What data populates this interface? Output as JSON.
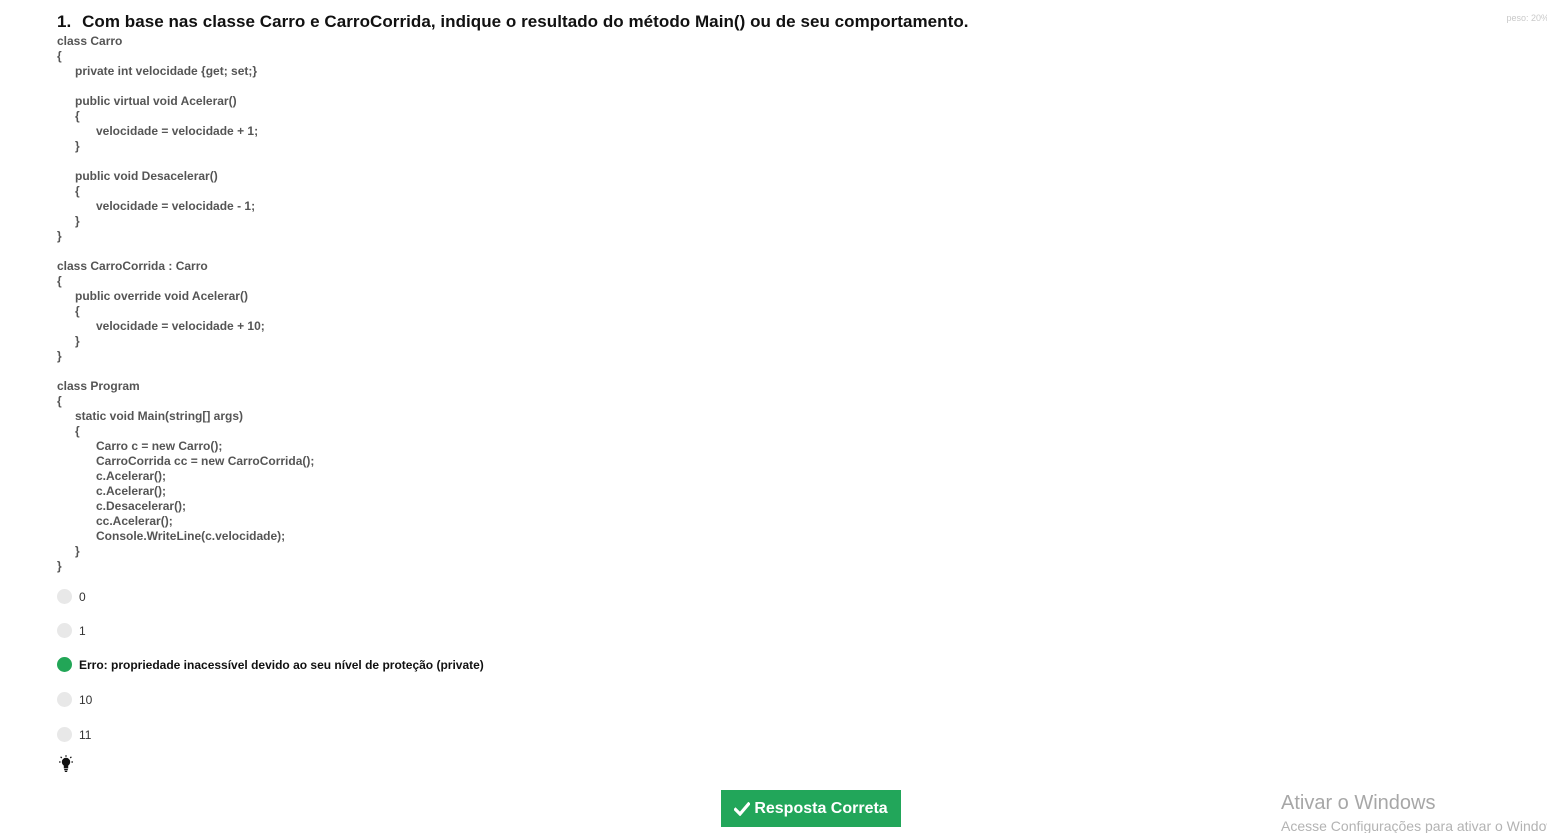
{
  "question": {
    "number": "1.",
    "text": "Com base nas classe Carro e CarroCorrida, indique o resultado do método Main() ou de seu comportamento.",
    "weight": "peso: 20%"
  },
  "code_lines": [
    "class Carro",
    "{",
    "private int velocidade {get; set;}",
    "",
    "public virtual void Acelerar()",
    "{",
    "velocidade = velocidade + 1;",
    "}",
    "",
    "public void Desacelerar()",
    "{",
    "velocidade = velocidade - 1;",
    "}",
    "}",
    "",
    "class CarroCorrida : Carro",
    "{",
    "public override void Acelerar()",
    "{",
    "velocidade = velocidade + 10;",
    "}",
    "}",
    "",
    "class Program",
    "{",
    "static void Main(string[] args)",
    "{",
    "Carro c = new Carro();",
    "CarroCorrida cc = new CarroCorrida();",
    "c.Acelerar();",
    "c.Acelerar();",
    "c.Desacelerar();",
    "cc.Acelerar();",
    "Console.WriteLine(c.velocidade);",
    "}",
    "}"
  ],
  "options": [
    {
      "label": "0"
    },
    {
      "label": "1"
    },
    {
      "label": "Erro: propriedade inacessível devido ao seu nível de proteção (private)"
    },
    {
      "label": "10"
    },
    {
      "label": "11"
    }
  ],
  "selected_option": 2,
  "hint_icon": "lightbulb-icon",
  "answer_button": {
    "label": "Resposta Correta",
    "color": "#22a65a"
  },
  "selected_color": "#22a657",
  "watermark": {
    "title": "Ativar o Windows",
    "subtitle": "Acesse Configurações para ativar o Windows."
  }
}
